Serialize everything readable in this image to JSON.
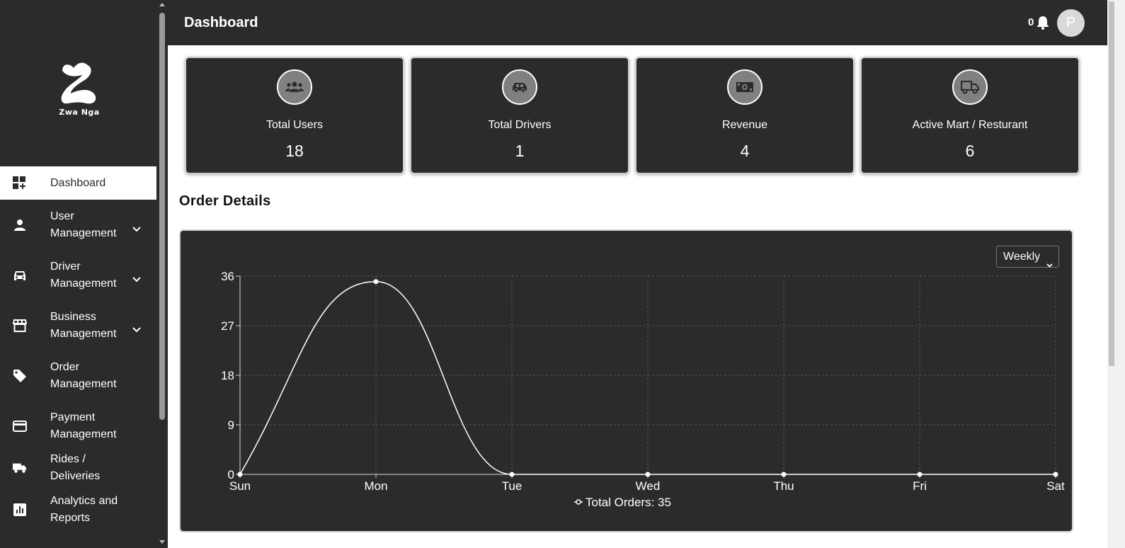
{
  "sidebar": {
    "brand": "Zwa Nga",
    "items": [
      {
        "label": "Dashboard",
        "icon": "dashboard-icon"
      },
      {
        "label": "User Management",
        "icon": "person-icon"
      },
      {
        "label": "Driver Management",
        "icon": "car-icon"
      },
      {
        "label": "Business Management",
        "icon": "store-icon"
      },
      {
        "label": "Order Management",
        "icon": "tag-icon"
      },
      {
        "label": "Payment Management",
        "icon": "credit-card-icon"
      },
      {
        "label": "Rides / Deliveries",
        "icon": "truck-icon"
      },
      {
        "label": "Analytics and Reports",
        "icon": "analytics-icon"
      }
    ]
  },
  "header": {
    "title": "Dashboard",
    "notification_count": "0",
    "avatar_initial": "P"
  },
  "stats": [
    {
      "label": "Total Users",
      "value": "18",
      "icon": "users-icon"
    },
    {
      "label": "Total Drivers",
      "value": "1",
      "icon": "car-icon"
    },
    {
      "label": "Revenue",
      "value": "4",
      "icon": "money-icon"
    },
    {
      "label": "Active Mart / Resturant",
      "value": "6",
      "icon": "truck-icon"
    }
  ],
  "orders": {
    "section_title": "Order Details",
    "period_selected": "Weekly"
  },
  "chart_data": {
    "type": "line",
    "categories": [
      "Sun",
      "Mon",
      "Tue",
      "Wed",
      "Thu",
      "Fri",
      "Sat"
    ],
    "series": [
      {
        "name": "Total Orders: 35",
        "values": [
          0,
          35,
          0,
          0,
          0,
          0,
          0
        ]
      }
    ],
    "yticks": [
      "0",
      "9",
      "18",
      "27",
      "36"
    ],
    "ylim": [
      0,
      36
    ],
    "grid": true,
    "legend": "bottom",
    "colors": {
      "line": "#ffffff",
      "grid": "#555555",
      "background": "#2b2b2b"
    }
  }
}
